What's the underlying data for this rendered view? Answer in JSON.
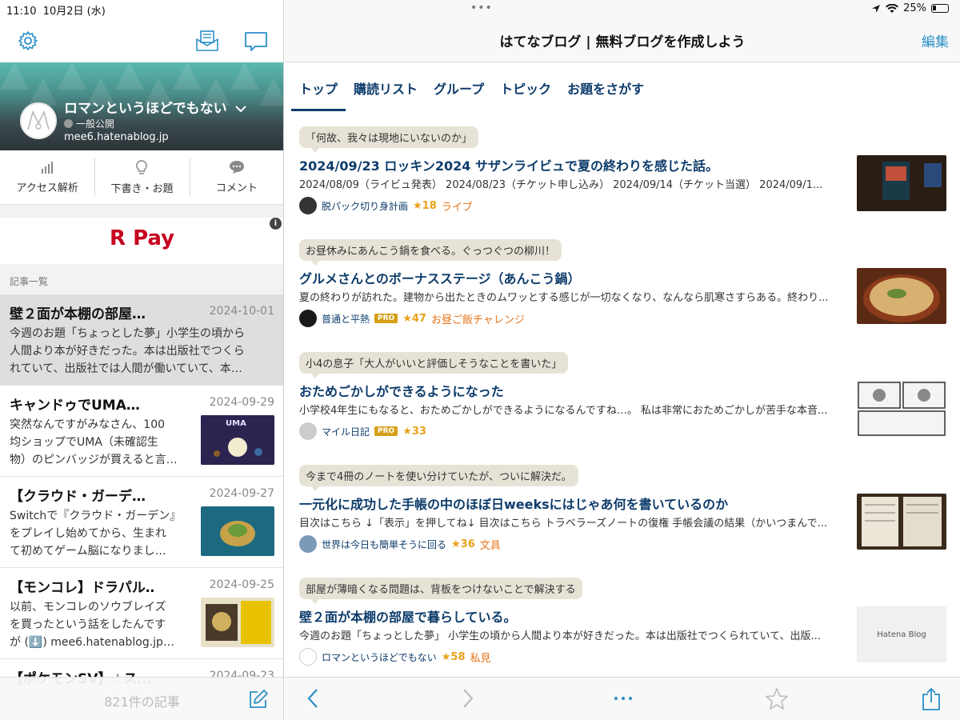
{
  "status": {
    "time": "11:10",
    "date": "10月2日 (水)",
    "battery": "25%",
    "more_dots": "•••"
  },
  "left": {
    "blog": {
      "name": "ロマンというほどでもない",
      "visibility": "一般公開",
      "url": "mee6.hatenablog.jp"
    },
    "tools": [
      {
        "label": "アクセス解析",
        "icon": "bar-chart-icon"
      },
      {
        "label": "下書き・お題",
        "icon": "lightbulb-icon"
      },
      {
        "label": "コメント",
        "icon": "speech-bubble-icon"
      }
    ],
    "ad": {
      "logo": "R Pay",
      "info": "i"
    },
    "list_label": "記事一覧",
    "entries": [
      {
        "title": "壁２面が本棚の部屋…",
        "date": "2024-10-01",
        "lines": [
          "今週のお題「ちょっとした夢」小学生の頃から",
          "人間より本が好きだった。本は出版社でつくら",
          "れていて、出版社では人間が働いていて、本…"
        ],
        "selected": true
      },
      {
        "title": "キャンドゥでUMA…",
        "date": "2024-09-29",
        "lines": [
          "突然なんですがみなさん、100",
          "均ショップでUMA（未確認生",
          "物）のピンバッジが買えると言…"
        ],
        "thumb_text": "UMA"
      },
      {
        "title": "【クラウド・ガーデ…",
        "date": "2024-09-27",
        "lines": [
          "Switchで『クラウド・ガーデン』",
          "をプレイし始めてから、生まれ",
          "て初めてゲーム脳になりまし…"
        ]
      },
      {
        "title": "【モンコレ】ドラパル…",
        "date": "2024-09-25",
        "lines": [
          "以前、モンコレのソウブレイズ",
          "を買ったという話をしたんです",
          "が (⬇️) mee6.hatenablog.jp…"
        ]
      },
      {
        "title": "【ポケモンSV】☆ス…",
        "date": "2024-09-23",
        "lines": []
      }
    ],
    "count": "821件の記事"
  },
  "right": {
    "title": "はてなブログ | 無料ブログを作成しよう",
    "edit": "編集",
    "tabs": [
      "トップ",
      "購読リスト",
      "グループ",
      "トピック",
      "お題をさがす"
    ],
    "cards": [
      {
        "bubble": "「何故、我々は現地にいないのか」",
        "title": "2024/09/23 ロッキン2024 サザンライビュで夏の終わりを感じた話。",
        "excerpt": "2024/08/09（ライビュ発表） 2024/08/23（チケット申し込み） 2024/09/14（チケット当選） 2024/09/1...",
        "blog": "脱パック切り身計画",
        "pro": false,
        "stars": "★18",
        "category": "ライブ"
      },
      {
        "bubble": "お昼休みにあんこう鍋を食べる。ぐっつぐつの柳川！",
        "title": "グルメさんとのボーナスステージ（あんこう鍋）",
        "excerpt": "夏の終わりが訪れた。建物から出たときのムワッとする感じが一切なくなり、なんなら肌寒さすらある。終わり...",
        "blog": "普通と平熱",
        "pro": true,
        "pro_label": "PRO",
        "stars": "★47",
        "category": "お昼ご飯チャレンジ"
      },
      {
        "bubble": "小4の息子「大人がいいと評価しそうなことを書いた」",
        "title": "おためごかしができるようになった",
        "excerpt": "小学校4年生にもなると、おためごかしができるようになるんですね…。 私は非常におためごかしが苦手な本音...",
        "blog": "マイル日記",
        "pro": true,
        "pro_label": "PRO",
        "stars": "★33",
        "category": ""
      },
      {
        "bubble": "今まで4冊のノートを使い分けていたが、ついに解決だ。",
        "title": "一元化に成功した手帳の中のほぼ日weeksにはじゃあ何を書いているのか",
        "excerpt": "目次はこちら ↓「表示」を押してね↓ 目次はこちら トラベラーズノートの復権 手帳会議の結果（かいつまんで...",
        "blog": "世界は今日も簡単そうに回る",
        "pro": false,
        "stars": "★36",
        "category": "文具"
      },
      {
        "bubble": "部屋が薄暗くなる問題は、背板をつけないことで解決する",
        "title": "壁２面が本棚の部屋で暮らしている。",
        "excerpt": "今週のお題「ちょっとした夢」 小学生の頃から人間より本が好きだった。本は出版社でつくられていて、出版...",
        "blog": "ロマンというほどでもない",
        "pro": false,
        "stars": "★58",
        "category": "私見",
        "thumb_text": "Hatena Blog"
      }
    ]
  }
}
